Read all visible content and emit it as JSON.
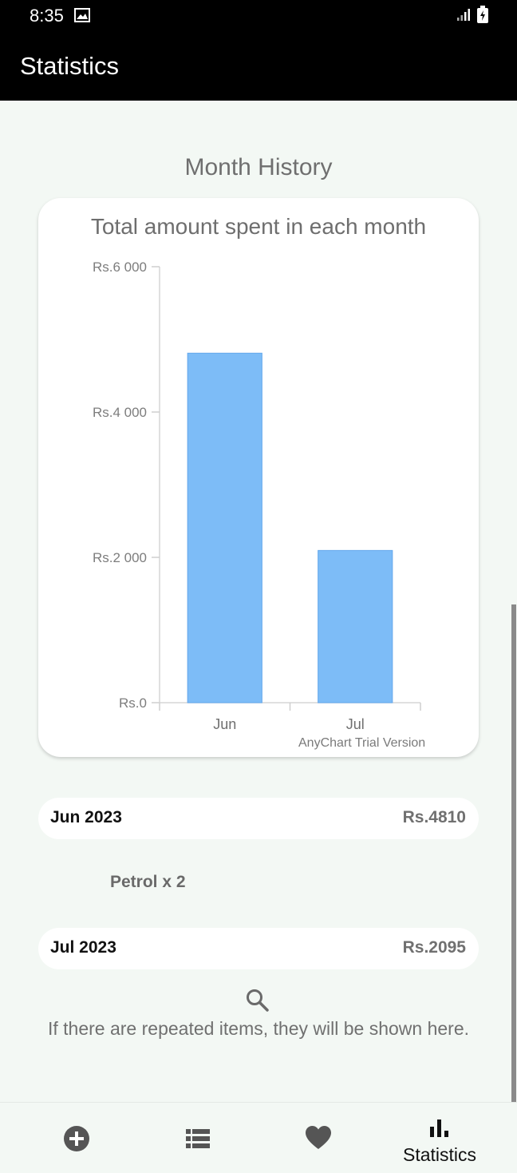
{
  "status_bar": {
    "time": "8:35",
    "icons": [
      "image-icon",
      "signal-icon",
      "battery-charging-icon"
    ]
  },
  "app_bar": {
    "title": "Statistics"
  },
  "section": {
    "title": "Month History"
  },
  "chart_data": {
    "type": "bar",
    "title": "Total amount spent in each month",
    "categories": [
      "Jun",
      "Jul"
    ],
    "values": [
      4810,
      2095
    ],
    "y_ticks": [
      "Rs.0",
      "Rs.2 000",
      "Rs.4 000",
      "Rs.6 000"
    ],
    "ylim": [
      0,
      6000
    ],
    "bar_color": "#7dbcf7",
    "watermark": "AnyChart Trial Version",
    "xlabel": "",
    "ylabel": ""
  },
  "months": [
    {
      "label": "Jun 2023",
      "amount": "Rs.4810"
    },
    {
      "label": "Jul 2023",
      "amount": "Rs.2095"
    }
  ],
  "repeated_items": [
    "Petrol x 2"
  ],
  "empty_state": {
    "icon": "search-icon",
    "message": "If there are repeated items, they will be shown here."
  },
  "bottom_nav": {
    "items": [
      {
        "icon": "add-circle-icon"
      },
      {
        "icon": "list-icon"
      },
      {
        "icon": "heart-icon"
      },
      {
        "icon": "bar-chart-icon",
        "label": "Statistics"
      }
    ]
  },
  "colors": {
    "app_bar": "#000000",
    "background": "#f3f8f4",
    "bar": "#7dbcf7",
    "card": "#ffffff"
  }
}
